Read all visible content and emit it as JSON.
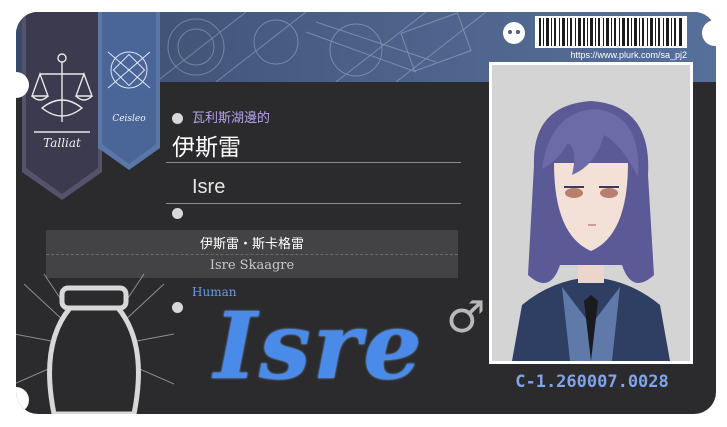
{
  "card": {
    "banner_left": "Talliat",
    "banner_right": "Ceisleo",
    "subtitle": "瓦利斯湖邊的",
    "name_zh": "伊斯雷",
    "name_en": "Isre",
    "fullname_zh": "伊斯雷・斯卡格雷",
    "fullname_en": "Isre Skaagre",
    "species": "Human",
    "signature": "Isre",
    "gender_symbol": "♂",
    "id_number": "C-1.260007.0028",
    "url": "https://www.plurk.com/sa_pj2"
  },
  "colors": {
    "card_bg": "#2b2b2d",
    "band": "#4b5f86",
    "accent_blue": "#4a8ae8",
    "subtitle_purple": "#b6a2ea",
    "id_blue": "#7fa4ec"
  },
  "icons": [
    "scales-icon",
    "lantern-icon",
    "plurk-logo-icon",
    "barcode-icon",
    "gender-male-icon"
  ]
}
